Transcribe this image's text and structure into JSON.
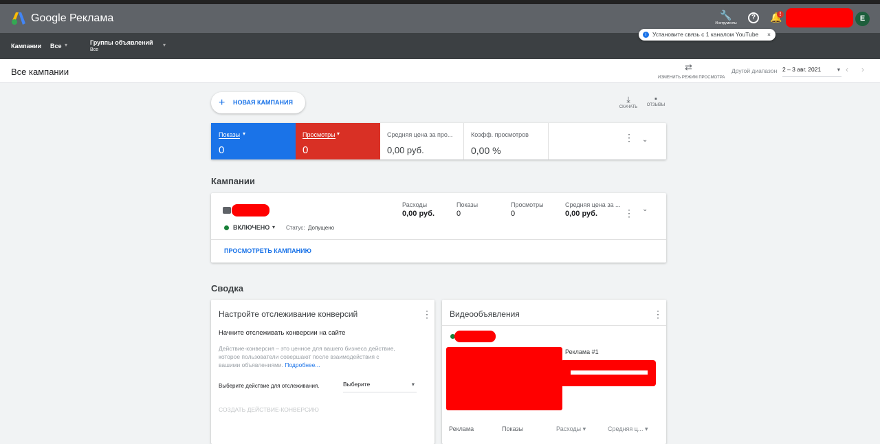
{
  "header": {
    "app_title": "Google Реклама",
    "tools_label": "Инструменты",
    "avatar_letter": "E",
    "notification_badge": "!"
  },
  "toast": {
    "text": "Установите связь с 1 каналом YouTube",
    "close": "×"
  },
  "subnav": {
    "campaigns_label": "Кампании",
    "campaigns_value": "Все",
    "adgroups_label": "Группы объявлений",
    "adgroups_value": "Все"
  },
  "titlebar": {
    "title": "Все кампании",
    "view_mode": "ИЗМЕНИТЬ РЕЖИМ ПРОСМОТРА",
    "range_label": "Другой диапазон",
    "range_value": "2 – 3 авг. 2021"
  },
  "actions": {
    "new_campaign": "НОВАЯ КАМПАНИЯ",
    "download": "СКАЧАТЬ",
    "feedback": "ОТЗЫВЫ"
  },
  "metrics": [
    {
      "label": "Показы",
      "value": "0",
      "color": "#1a73e8"
    },
    {
      "label": "Просмотры",
      "value": "0",
      "color": "#d93025"
    },
    {
      "label": "Средняя цена за про...",
      "value": "0,00 руб."
    },
    {
      "label": "Коэфф. просмотров",
      "value": "0,00 %"
    }
  ],
  "campaigns": {
    "heading": "Кампании",
    "status": "ВКЛЮЧЕНО",
    "status_label": "Статус:",
    "status_value": "Допущено",
    "stats": [
      {
        "label": "Расходы",
        "value": "0,00 руб."
      },
      {
        "label": "Показы",
        "value": "0"
      },
      {
        "label": "Просмотры",
        "value": "0"
      },
      {
        "label": "Средняя цена за ...",
        "value": "0,00 руб."
      }
    ],
    "view_link": "ПРОСМОТРЕТЬ КАМПАНИЮ"
  },
  "summary": {
    "heading": "Сводка",
    "conversion": {
      "title": "Настройте отслеживание конверсий",
      "subtitle": "Начните отслеживать конверсии на сайте",
      "description": "Действие-конверсия – это ценное для вашего бизнеса действие, которое пользователи совершают после взаимодействия с вашими объявлениями.",
      "more_link": "Подробнее...",
      "select_label": "Выберите действие для отслеживания.",
      "select_value": "Выберите",
      "create_button": "СОЗДАТЬ ДЕЙСТВИЕ-КОНВЕРСИЮ"
    },
    "video": {
      "title": "Видеообъявления",
      "ad_name": "Реклама #1",
      "columns": [
        "Реклама",
        "Показы",
        "Расходы",
        "Средняя ц..."
      ]
    }
  }
}
